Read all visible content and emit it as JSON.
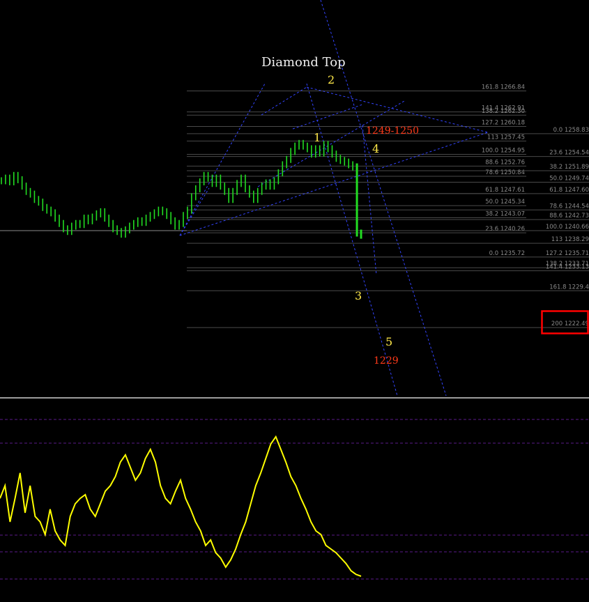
{
  "colors": {
    "background": "#000000",
    "price_bar": "#22dd22",
    "fib_line": "#4a4a4a",
    "fib_text": "#8a8a8a",
    "trendline": "#3344ff",
    "oscillator": "#ffff00",
    "osc_level": "#5a1a8a",
    "wave_label": "#ffe94a",
    "target_label": "#ff3a1a",
    "highlight_box": "#ff0000"
  },
  "annotations": {
    "pattern_title": "Diamond Top",
    "wave_1": "1",
    "wave_2": "2",
    "wave_3": "3",
    "wave_4": "4",
    "wave_5": "5",
    "resistance_zone": "1249-1250",
    "target": "1229"
  },
  "chart_data": {
    "type": "line",
    "fib_set_left": [
      {
        "level": "161.8",
        "price": "1266.84"
      },
      {
        "level": "141.4",
        "price": "1262.91"
      },
      {
        "level": "138.2",
        "price": "1262.30"
      },
      {
        "level": "127.2",
        "price": "1260.18"
      },
      {
        "level": "113",
        "price": "1257.45"
      },
      {
        "level": "100.0",
        "price": "1254.95"
      },
      {
        "level": "88.6",
        "price": "1252.76"
      },
      {
        "level": "78.6",
        "price": "1250.84"
      },
      {
        "level": "61.8",
        "price": "1247.61"
      },
      {
        "level": "50.0",
        "price": "1245.34"
      },
      {
        "level": "38.2",
        "price": "1243.07"
      },
      {
        "level": "23.6",
        "price": "1240.26"
      },
      {
        "level": "0.0",
        "price": "1235.72"
      }
    ],
    "fib_set_right": [
      {
        "level": "0.0",
        "price": "1258.83"
      },
      {
        "level": "23.6",
        "price": "1254.54"
      },
      {
        "level": "38.2",
        "price": "1251.89"
      },
      {
        "level": "50.0",
        "price": "1249.74"
      },
      {
        "level": "61.8",
        "price": "1247.60"
      },
      {
        "level": "78.6",
        "price": "1244.54"
      },
      {
        "level": "88.6",
        "price": "1242.73"
      },
      {
        "level": "100.0",
        "price": "1240.66"
      },
      {
        "level": "113",
        "price": "1238.29"
      },
      {
        "level": "127.2",
        "price": "1235.71"
      },
      {
        "level": "138.2",
        "price": "1233.71"
      },
      {
        "level": "141.4",
        "price": "1233.13"
      },
      {
        "level": "161.8",
        "price": "1229.4"
      },
      {
        "level": "200",
        "price": "1222.49"
      }
    ],
    "price_close": [
      1250,
      1250.5,
      1249.8,
      1251,
      1250.2,
      1249,
      1248,
      1247.5,
      1246.5,
      1246,
      1245,
      1244.5,
      1244,
      1243,
      1242,
      1241,
      1240.5,
      1241.5,
      1242,
      1241.8,
      1243,
      1242.5,
      1243.2,
      1243.8,
      1244.2,
      1243,
      1242,
      1241,
      1240.5,
      1240,
      1240.8,
      1241.5,
      1242,
      1242.5,
      1242.2,
      1243,
      1243.5,
      1244,
      1244.5,
      1244.2,
      1243.5,
      1242.5,
      1241.5,
      1242,
      1243.5,
      1244.5,
      1247,
      1248.5,
      1249.8,
      1251,
      1250.5,
      1249.5,
      1250.5,
      1249,
      1248,
      1246.5,
      1248,
      1249.5,
      1250.5,
      1248.5,
      1247.5,
      1246.5,
      1248,
      1249,
      1249.6,
      1249,
      1250,
      1251.5,
      1253,
      1254,
      1255.5,
      1256.5,
      1257,
      1256.5,
      1256,
      1255,
      1256,
      1255.2,
      1256.8,
      1256,
      1255,
      1254.2,
      1253.8,
      1253.5,
      1253,
      1252.6,
      1240.2,
      1239.8
    ],
    "oscillator": [
      48,
      55,
      35,
      48,
      62,
      40,
      55,
      38,
      35,
      28,
      42,
      30,
      25,
      22,
      38,
      45,
      48,
      50,
      42,
      38,
      45,
      52,
      55,
      60,
      68,
      72,
      65,
      58,
      62,
      70,
      75,
      68,
      55,
      48,
      45,
      52,
      58,
      48,
      42,
      35,
      30,
      22,
      25,
      18,
      15,
      10,
      14,
      20,
      28,
      35,
      45,
      55,
      62,
      70,
      78,
      82,
      75,
      68,
      60,
      55,
      48,
      42,
      35,
      30,
      28,
      22,
      20,
      18,
      15,
      12,
      8,
      6,
      5
    ]
  }
}
